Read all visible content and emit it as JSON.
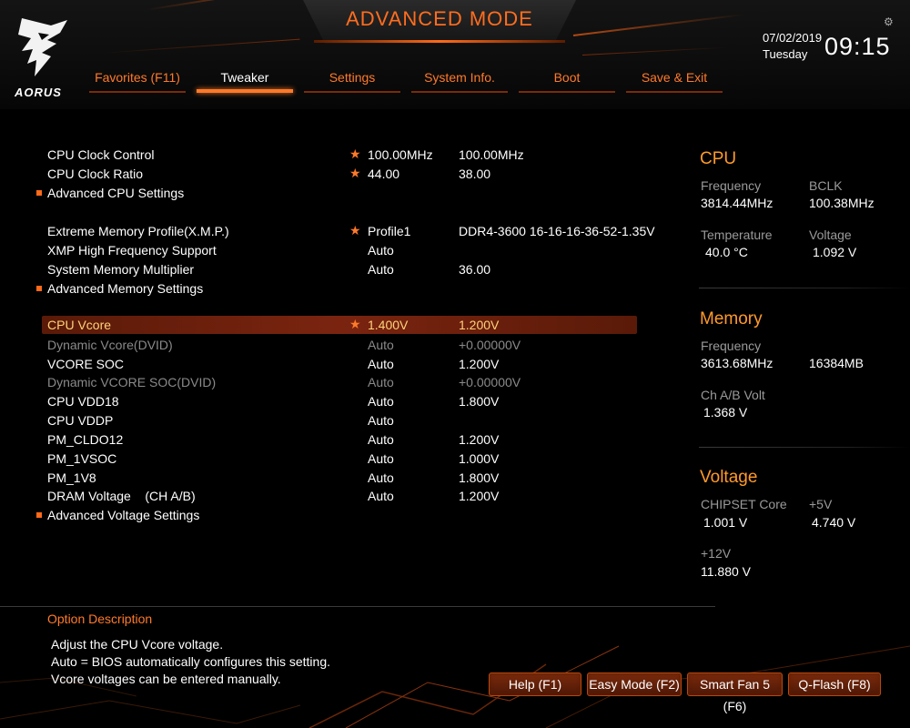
{
  "header": {
    "title": "ADVANCED MODE",
    "logo_text": "AORUS",
    "date": "07/02/2019",
    "day": "Tuesday",
    "time": "09:15",
    "accent_color": "#ff6d1f"
  },
  "tabs": [
    {
      "label": "Favorites (F11)",
      "active": false
    },
    {
      "label": "Tweaker",
      "active": true
    },
    {
      "label": "Settings",
      "active": false
    },
    {
      "label": "System Info.",
      "active": false
    },
    {
      "label": "Boot",
      "active": false
    },
    {
      "label": "Save & Exit",
      "active": false
    }
  ],
  "settings": {
    "cpu_clock_control": {
      "name": "CPU Clock Control",
      "value": "100.00MHz",
      "current": "100.00MHz"
    },
    "cpu_clock_ratio": {
      "name": "CPU Clock Ratio",
      "value": "44.00",
      "current": "38.00"
    },
    "advanced_cpu": {
      "name": "Advanced CPU Settings"
    },
    "xmp": {
      "name": "Extreme Memory Profile(X.M.P.)",
      "value": "Profile1",
      "current": "DDR4-3600 16-16-16-36-52-1.35V"
    },
    "xmp_high_freq": {
      "name": "XMP High Frequency Support",
      "value": "Auto"
    },
    "sys_mem_mult": {
      "name": "System Memory Multiplier",
      "value": "Auto",
      "current": "36.00"
    },
    "advanced_memory": {
      "name": "Advanced Memory Settings"
    },
    "cpu_vcore": {
      "name": "CPU Vcore",
      "value": "1.400V",
      "current": "1.200V"
    },
    "dyn_vcore": {
      "name": "Dynamic Vcore(DVID)",
      "value": "Auto",
      "current": "+0.00000V"
    },
    "vcore_soc": {
      "name": "VCORE SOC",
      "value": "Auto",
      "current": "1.200V"
    },
    "dyn_vcore_soc": {
      "name": "Dynamic VCORE SOC(DVID)",
      "value": "Auto",
      "current": "+0.00000V"
    },
    "cpu_vdd18": {
      "name": "CPU VDD18",
      "value": "Auto",
      "current": "1.800V"
    },
    "cpu_vddp": {
      "name": "CPU VDDP",
      "value": "Auto"
    },
    "pm_cldo12": {
      "name": "PM_CLDO12",
      "value": "Auto",
      "current": "1.200V"
    },
    "pm_1vsoc": {
      "name": "PM_1VSOC",
      "value": "Auto",
      "current": "1.000V"
    },
    "pm_1v8": {
      "name": "PM_1V8",
      "value": "Auto",
      "current": "1.800V"
    },
    "dram_voltage": {
      "name": "DRAM Voltage    (CH A/B)",
      "value": "Auto",
      "current": "1.200V"
    },
    "advanced_voltage": {
      "name": "Advanced Voltage Settings"
    }
  },
  "panel": {
    "cpu": {
      "title": "CPU",
      "frequency_label": "Frequency",
      "frequency": "3814.44MHz",
      "bclk_label": "BCLK",
      "bclk": "100.38MHz",
      "temperature_label": "Temperature",
      "temperature": "40.0 °C",
      "voltage_label": "Voltage",
      "voltage": "1.092 V"
    },
    "memory": {
      "title": "Memory",
      "frequency_label": "Frequency",
      "frequency": "3613.68MHz",
      "size": "16384MB",
      "volt_label": "Ch A/B Volt",
      "volt": "1.368 V"
    },
    "voltage": {
      "title": "Voltage",
      "chipset_label": "CHIPSET Core",
      "chipset": "1.001 V",
      "v5_label": "+5V",
      "v5": "4.740 V",
      "v12_label": "+12V",
      "v12": "11.880 V"
    }
  },
  "description": {
    "title": "Option Description",
    "line1": "Adjust the CPU Vcore voltage.",
    "line2": "Auto = BIOS automatically configures this setting.",
    "line3": "Vcore voltages can be entered manually."
  },
  "buttons": {
    "help": "Help (F1)",
    "easy_mode": "Easy Mode (F2)",
    "smart_fan": "Smart Fan 5 (F6)",
    "qflash": "Q-Flash (F8)"
  }
}
